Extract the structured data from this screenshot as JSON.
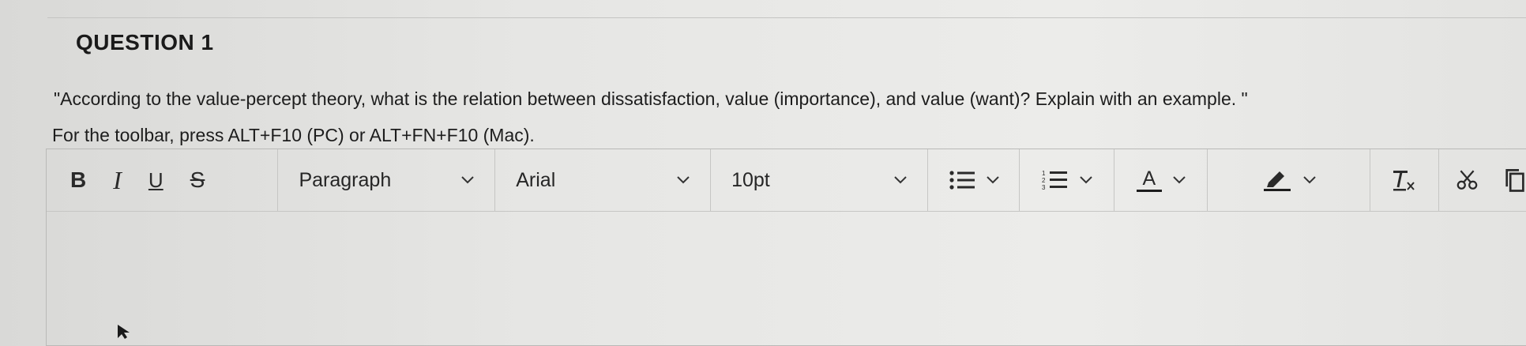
{
  "question": {
    "title": "QUESTION 1",
    "text": "\"According to the value-percept theory, what is the relation between dissatisfaction, value (importance), and value (want)? Explain with an example. \"",
    "toolbar_hint": "For the toolbar, press ALT+F10 (PC) or ALT+FN+F10 (Mac)."
  },
  "toolbar": {
    "bold_label": "B",
    "italic_label": "I",
    "underline_label": "U",
    "strikethrough_label": "S",
    "paragraph_select": "Paragraph",
    "font_select": "Arial",
    "size_select": "10pt",
    "text_color_label": "A",
    "icons": [
      "bullet-list-icon",
      "numbered-list-icon",
      "text-color-icon",
      "highlight-icon",
      "clear-formatting-icon",
      "cut-icon",
      "copy-icon"
    ]
  },
  "colors": {
    "text": "#1d1d1d",
    "border": "#c6c6c4",
    "background": "#e6e6e4"
  },
  "editor": {
    "content": ""
  }
}
